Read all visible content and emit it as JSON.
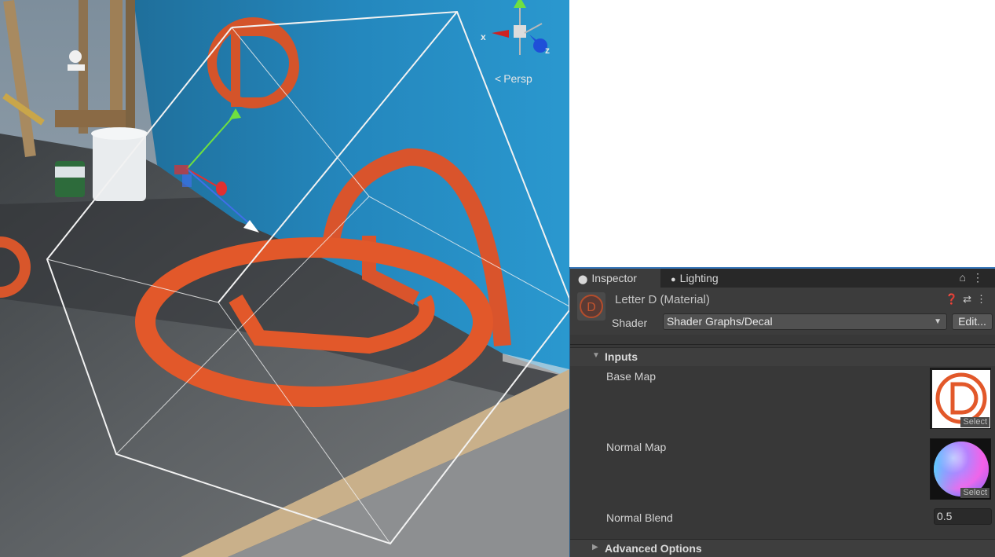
{
  "scene": {
    "view_mode_label": "Persp",
    "axis_x_label": "x",
    "axis_z_label": "z",
    "icons": [
      "scene-gizmo-icon",
      "move-gizmo-icon",
      "light-probe-icon"
    ]
  },
  "inspector": {
    "tabs": [
      {
        "label": "Inspector",
        "icon": "info-icon"
      },
      {
        "label": "Lighting",
        "icon": "lightbulb-icon"
      }
    ],
    "tab_tools": [
      "lock-icon",
      "kebab-menu-icon"
    ],
    "material": {
      "title": "Letter D (Material)",
      "icon": "material-preview-icon",
      "header_tools": [
        "help-icon",
        "preset-icon",
        "kebab-menu-icon"
      ]
    },
    "shader": {
      "label": "Shader",
      "value": "Shader Graphs/Decal",
      "edit_label": "Edit..."
    },
    "inputs": {
      "title": "Inputs",
      "base_map": {
        "label": "Base Map",
        "select_label": "Select"
      },
      "normal_map": {
        "label": "Normal Map",
        "select_label": "Select"
      },
      "normal_blend": {
        "label": "Normal Blend",
        "value": "0.5"
      }
    },
    "advanced": {
      "title": "Advanced Options"
    },
    "colors": {
      "accent": "#3a79bb",
      "panel": "#383838",
      "decal_orange": "#e2582a"
    }
  }
}
